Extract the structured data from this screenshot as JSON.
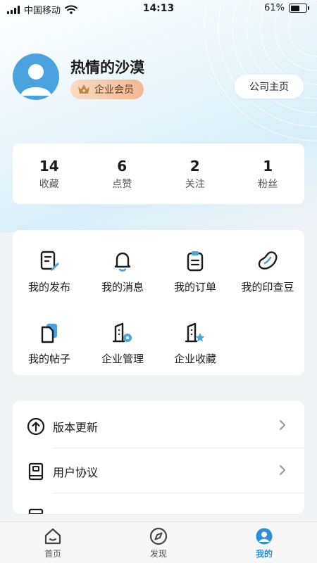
{
  "status_bar": {
    "carrier": "中国移动",
    "time": "14:13",
    "battery": "61%",
    "battery_level": 0.61
  },
  "profile": {
    "username": "热情的沙漠",
    "member_badge": "企业会员",
    "company_button": "公司主页"
  },
  "stats": [
    {
      "value": "14",
      "label": "收藏"
    },
    {
      "value": "6",
      "label": "点赞"
    },
    {
      "value": "2",
      "label": "关注"
    },
    {
      "value": "1",
      "label": "粉丝"
    }
  ],
  "grid": [
    {
      "label": "我的发布",
      "icon": "edit-document-icon"
    },
    {
      "label": "我的消息",
      "icon": "bell-icon"
    },
    {
      "label": "我的订单",
      "icon": "clipboard-icon"
    },
    {
      "label": "我的印查豆",
      "icon": "bean-icon"
    },
    {
      "label": "我的帖子",
      "icon": "documents-icon"
    },
    {
      "label": "企业管理",
      "icon": "building-gear-icon"
    },
    {
      "label": "企业收藏",
      "icon": "building-star-icon"
    }
  ],
  "list": [
    {
      "label": "版本更新",
      "icon": "arrow-up-circle-icon"
    },
    {
      "label": "用户协议",
      "icon": "agreement-book-icon"
    }
  ],
  "tabbar": [
    {
      "label": "首页",
      "icon": "home-icon"
    },
    {
      "label": "发现",
      "icon": "compass-icon"
    },
    {
      "label": "我的",
      "icon": "user-circle-icon",
      "active": true
    }
  ],
  "colors": {
    "accent": "#2a8fd8",
    "avatar": "#4aa3df",
    "badge_text": "#6b3a17"
  }
}
